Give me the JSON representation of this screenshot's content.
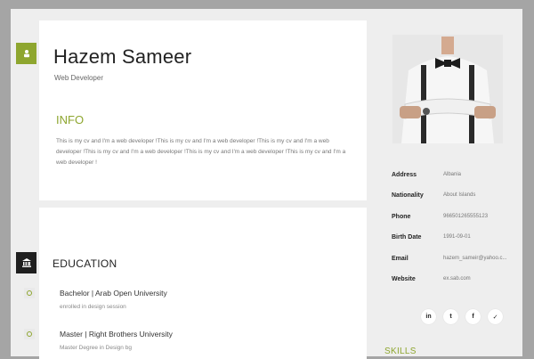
{
  "profile": {
    "name": "Hazem Sameer",
    "role": "Web Developer"
  },
  "info": {
    "heading": "INFO",
    "text": "This is my cv and I'm a web developer !This is my cv and I'm a web developer !This is my cv and I'm a web developer !This is my cv and I'm a web developer !This is my cv and I'm a web developer !This is my cv and I'm a web developer !"
  },
  "education": {
    "heading": "EDUCATION",
    "items": [
      {
        "title": "Bachelor | Arab Open University",
        "desc": "enrolled in design session"
      },
      {
        "title": "Master | Right Brothers University",
        "desc": "Master Degree in Design bg"
      }
    ]
  },
  "details": [
    {
      "key": "Address",
      "value": "Albania"
    },
    {
      "key": "Nationality",
      "value": "About Islands"
    },
    {
      "key": "Phone",
      "value": "966501265555123"
    },
    {
      "key": "Birth Date",
      "value": "1991-09-01"
    },
    {
      "key": "Email",
      "value": "hazem_sameir@yahoo.c..."
    },
    {
      "key": "Website",
      "value": "ex.sab.com"
    }
  ],
  "socials": [
    {
      "name": "linkedin-icon",
      "glyph": "in"
    },
    {
      "name": "tumblr-icon",
      "glyph": "t"
    },
    {
      "name": "facebook-icon",
      "glyph": "f"
    },
    {
      "name": "twitter-icon",
      "glyph": "✓"
    }
  ],
  "skills": {
    "heading": "SKILLS"
  },
  "colors": {
    "accent": "#8ea62f",
    "dark": "#1f1f1f",
    "background": "#eeeeee"
  }
}
